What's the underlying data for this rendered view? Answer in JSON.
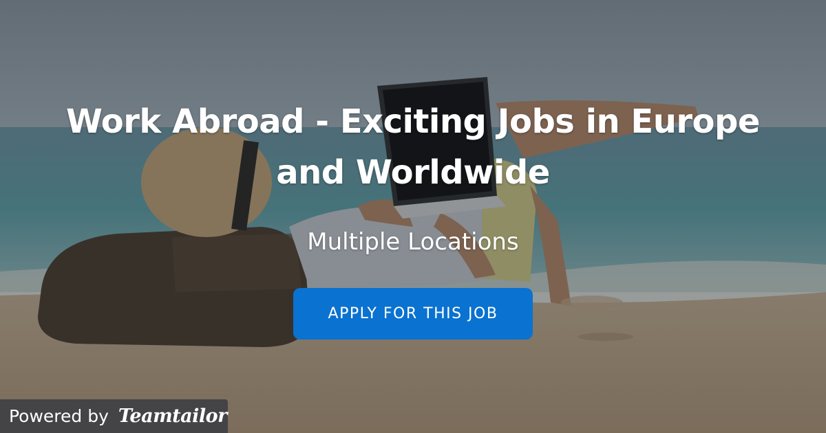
{
  "job": {
    "title": "Work Abroad - Exciting Jobs in Europe and Worldwide",
    "locations": "Multiple Locations",
    "apply_label": "APPLY FOR THIS JOB"
  },
  "footer": {
    "powered_by": "Powered by",
    "brand": "Teamtailor"
  },
  "colors": {
    "accent": "#0a72d0",
    "overlay": "#1e2228",
    "text": "#ffffff"
  }
}
